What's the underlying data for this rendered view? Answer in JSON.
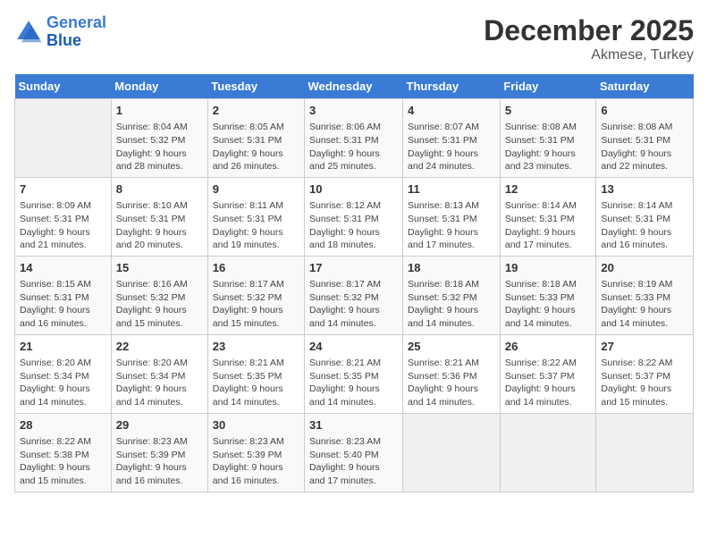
{
  "logo": {
    "line1": "General",
    "line2": "Blue"
  },
  "title": "December 2025",
  "subtitle": "Akmese, Turkey",
  "days_of_week": [
    "Sunday",
    "Monday",
    "Tuesday",
    "Wednesday",
    "Thursday",
    "Friday",
    "Saturday"
  ],
  "weeks": [
    [
      {
        "day": "",
        "info": ""
      },
      {
        "day": "1",
        "info": "Sunrise: 8:04 AM\nSunset: 5:32 PM\nDaylight: 9 hours\nand 28 minutes."
      },
      {
        "day": "2",
        "info": "Sunrise: 8:05 AM\nSunset: 5:31 PM\nDaylight: 9 hours\nand 26 minutes."
      },
      {
        "day": "3",
        "info": "Sunrise: 8:06 AM\nSunset: 5:31 PM\nDaylight: 9 hours\nand 25 minutes."
      },
      {
        "day": "4",
        "info": "Sunrise: 8:07 AM\nSunset: 5:31 PM\nDaylight: 9 hours\nand 24 minutes."
      },
      {
        "day": "5",
        "info": "Sunrise: 8:08 AM\nSunset: 5:31 PM\nDaylight: 9 hours\nand 23 minutes."
      },
      {
        "day": "6",
        "info": "Sunrise: 8:08 AM\nSunset: 5:31 PM\nDaylight: 9 hours\nand 22 minutes."
      }
    ],
    [
      {
        "day": "7",
        "info": "Sunrise: 8:09 AM\nSunset: 5:31 PM\nDaylight: 9 hours\nand 21 minutes."
      },
      {
        "day": "8",
        "info": "Sunrise: 8:10 AM\nSunset: 5:31 PM\nDaylight: 9 hours\nand 20 minutes."
      },
      {
        "day": "9",
        "info": "Sunrise: 8:11 AM\nSunset: 5:31 PM\nDaylight: 9 hours\nand 19 minutes."
      },
      {
        "day": "10",
        "info": "Sunrise: 8:12 AM\nSunset: 5:31 PM\nDaylight: 9 hours\nand 18 minutes."
      },
      {
        "day": "11",
        "info": "Sunrise: 8:13 AM\nSunset: 5:31 PM\nDaylight: 9 hours\nand 17 minutes."
      },
      {
        "day": "12",
        "info": "Sunrise: 8:14 AM\nSunset: 5:31 PM\nDaylight: 9 hours\nand 17 minutes."
      },
      {
        "day": "13",
        "info": "Sunrise: 8:14 AM\nSunset: 5:31 PM\nDaylight: 9 hours\nand 16 minutes."
      }
    ],
    [
      {
        "day": "14",
        "info": "Sunrise: 8:15 AM\nSunset: 5:31 PM\nDaylight: 9 hours\nand 16 minutes."
      },
      {
        "day": "15",
        "info": "Sunrise: 8:16 AM\nSunset: 5:32 PM\nDaylight: 9 hours\nand 15 minutes."
      },
      {
        "day": "16",
        "info": "Sunrise: 8:17 AM\nSunset: 5:32 PM\nDaylight: 9 hours\nand 15 minutes."
      },
      {
        "day": "17",
        "info": "Sunrise: 8:17 AM\nSunset: 5:32 PM\nDaylight: 9 hours\nand 14 minutes."
      },
      {
        "day": "18",
        "info": "Sunrise: 8:18 AM\nSunset: 5:32 PM\nDaylight: 9 hours\nand 14 minutes."
      },
      {
        "day": "19",
        "info": "Sunrise: 8:18 AM\nSunset: 5:33 PM\nDaylight: 9 hours\nand 14 minutes."
      },
      {
        "day": "20",
        "info": "Sunrise: 8:19 AM\nSunset: 5:33 PM\nDaylight: 9 hours\nand 14 minutes."
      }
    ],
    [
      {
        "day": "21",
        "info": "Sunrise: 8:20 AM\nSunset: 5:34 PM\nDaylight: 9 hours\nand 14 minutes."
      },
      {
        "day": "22",
        "info": "Sunrise: 8:20 AM\nSunset: 5:34 PM\nDaylight: 9 hours\nand 14 minutes."
      },
      {
        "day": "23",
        "info": "Sunrise: 8:21 AM\nSunset: 5:35 PM\nDaylight: 9 hours\nand 14 minutes."
      },
      {
        "day": "24",
        "info": "Sunrise: 8:21 AM\nSunset: 5:35 PM\nDaylight: 9 hours\nand 14 minutes."
      },
      {
        "day": "25",
        "info": "Sunrise: 8:21 AM\nSunset: 5:36 PM\nDaylight: 9 hours\nand 14 minutes."
      },
      {
        "day": "26",
        "info": "Sunrise: 8:22 AM\nSunset: 5:37 PM\nDaylight: 9 hours\nand 14 minutes."
      },
      {
        "day": "27",
        "info": "Sunrise: 8:22 AM\nSunset: 5:37 PM\nDaylight: 9 hours\nand 15 minutes."
      }
    ],
    [
      {
        "day": "28",
        "info": "Sunrise: 8:22 AM\nSunset: 5:38 PM\nDaylight: 9 hours\nand 15 minutes."
      },
      {
        "day": "29",
        "info": "Sunrise: 8:23 AM\nSunset: 5:39 PM\nDaylight: 9 hours\nand 16 minutes."
      },
      {
        "day": "30",
        "info": "Sunrise: 8:23 AM\nSunset: 5:39 PM\nDaylight: 9 hours\nand 16 minutes."
      },
      {
        "day": "31",
        "info": "Sunrise: 8:23 AM\nSunset: 5:40 PM\nDaylight: 9 hours\nand 17 minutes."
      },
      {
        "day": "",
        "info": ""
      },
      {
        "day": "",
        "info": ""
      },
      {
        "day": "",
        "info": ""
      }
    ]
  ]
}
